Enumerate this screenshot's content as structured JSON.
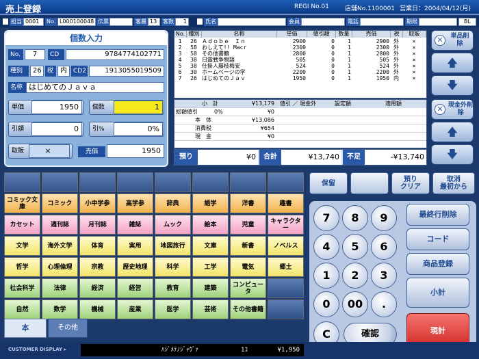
{
  "window": {
    "title": "売上登録",
    "regi": "REGI No.01",
    "store": "店舗No.1100001",
    "bizdate": "営業日：2004/04/12(月)"
  },
  "info": {
    "tanto_label": "担当",
    "tanto": "0001",
    "no_label": "No.",
    "no": "L000100048",
    "denpyo_label": "伝票",
    "kyakuso_label": "客層",
    "kyakuso": "13",
    "kyakusu_label": "客数",
    "kyakusu": "1",
    "shimei_label": "氏名",
    "kaiin_label": "会員",
    "tel_label": "電話",
    "kikan_label": "期限",
    "bl": "BL"
  },
  "entry": {
    "title": "個数入力",
    "no_label": "No.",
    "no": "7",
    "cd_label": "CD",
    "cd": "9784774102771",
    "shubetsu_label": "種別",
    "shubetsu": "26",
    "zei_label": "税",
    "zei": "内",
    "cd2_label": "CD2",
    "cd2": "1913055019509",
    "name_label": "名称",
    "name": "はじめてのＪａｖａ",
    "tanka_label": "単価",
    "tanka": "1950",
    "kosu_label": "個数",
    "kosu": "1",
    "hikigaku_label": "引額",
    "hikigaku": "0",
    "hikiritsu_label": "引%",
    "hikiritsu": "0%",
    "torihan_label": "取販",
    "torihan": "×",
    "baika_label": "売価",
    "baika": "1950"
  },
  "table": {
    "headers": [
      "No.",
      "種別",
      "名称",
      "単価",
      "値引額",
      "数量",
      "売価",
      "税",
      "取販"
    ],
    "rows": [
      [
        "1",
        "26",
        "Ａｄｏｂｅ　Ｉｎ",
        "2900",
        "0",
        "1",
        "2900",
        "外",
        "×"
      ],
      [
        "2",
        "58",
        "おしえて!! Macr",
        "2300",
        "0",
        "1",
        "2300",
        "外",
        "×"
      ],
      [
        "3",
        "58",
        "その他書籍",
        "2800",
        "0",
        "1",
        "2800",
        "外",
        "×"
      ],
      [
        "4",
        "38",
        "日露戦争物語",
        "505",
        "0",
        "1",
        "505",
        "外",
        "×"
      ],
      [
        "5",
        "38",
        "仕掛人藤枝梅安",
        "524",
        "0",
        "1",
        "524",
        "外",
        "×"
      ],
      [
        "6",
        "30",
        "ホームページの学",
        "2200",
        "0",
        "1",
        "2200",
        "外",
        "×"
      ],
      [
        "7",
        "26",
        "はじめてのＪａｖ",
        "1950",
        "0",
        "1",
        "1950",
        "内",
        "×"
      ]
    ]
  },
  "summary": {
    "shokei_label": "小　計",
    "shokei": "¥13,179",
    "sonebiki_label": "総額値引",
    "sonebiki_pct": "0%",
    "sonebiki": "¥0",
    "hontai_label": "本　体",
    "hontai": "¥13,086",
    "shohizei_label": "消費税",
    "shohizei": "¥654",
    "genkin_label": "現　金",
    "genkin": "¥0",
    "col2": "値引 ／ 現金外",
    "col3": "設定額",
    "col4": "適用額"
  },
  "pay": {
    "azukari_label": "預り",
    "azukari": "¥0",
    "gokei_label": "合計",
    "gokei": "¥13,740",
    "fusoku_label": "不足",
    "fusoku": "-¥13,740"
  },
  "side": {
    "tanpin_sakujo": "単品削除",
    "genkingai_sakujo": "現金外削除"
  },
  "action": {
    "hozon": "保留",
    "azukari_clear": "預り\nクリア",
    "torikeshi": "取消\n最初から"
  },
  "categories": [
    [
      "",
      "",
      "",
      "",
      "",
      "",
      "",
      ""
    ],
    [
      "コミック文庫",
      "コミック",
      "小中学参",
      "高学参",
      "辞典",
      "語学",
      "洋書",
      "趣書"
    ],
    [
      "カセット",
      "週刊誌",
      "月刊誌",
      "雑誌",
      "ムック",
      "絵本",
      "児童",
      "キャラクター"
    ],
    [
      "文学",
      "海外文学",
      "体育",
      "実用",
      "地図旅行",
      "文庫",
      "新書",
      "ノベルス"
    ],
    [
      "哲学",
      "心理倫理",
      "宗教",
      "歴史地理",
      "科学",
      "工学",
      "電気",
      "郷土"
    ],
    [
      "社会科学",
      "法律",
      "経済",
      "経営",
      "教育",
      "建築",
      "コンピュータ",
      ""
    ],
    [
      "自然",
      "数学",
      "機械",
      "産業",
      "医学",
      "芸術",
      "その他書籍",
      ""
    ]
  ],
  "tabs": {
    "hon": "本",
    "sonota": "その他"
  },
  "keys": {
    "k7": "7",
    "k8": "8",
    "k9": "9",
    "k4": "4",
    "k5": "5",
    "k6": "6",
    "k1": "1",
    "k2": "2",
    "k3": "3",
    "k0": "0",
    "k00": "00",
    "kdot": ".",
    "kc": "C",
    "kakunin": "確認"
  },
  "func": {
    "saishugyo": "最終行削除",
    "code": "コード",
    "shohin": "商品登録",
    "shokei": "小計",
    "genkei": "現計"
  },
  "customer": {
    "label": "CUSTOMER DISPLAY ▸",
    "item": "ﾊｼﾞﾒﾃﾉｼﾞｬｳﾞｧ",
    "qty": "1ｺ",
    "price": "¥1,950"
  },
  "colors": {
    "title_bar": "#1e5fb6",
    "background": "#1b3a6b",
    "genkei": "#e0403a",
    "kosu_highlight": "#f5e81b"
  }
}
